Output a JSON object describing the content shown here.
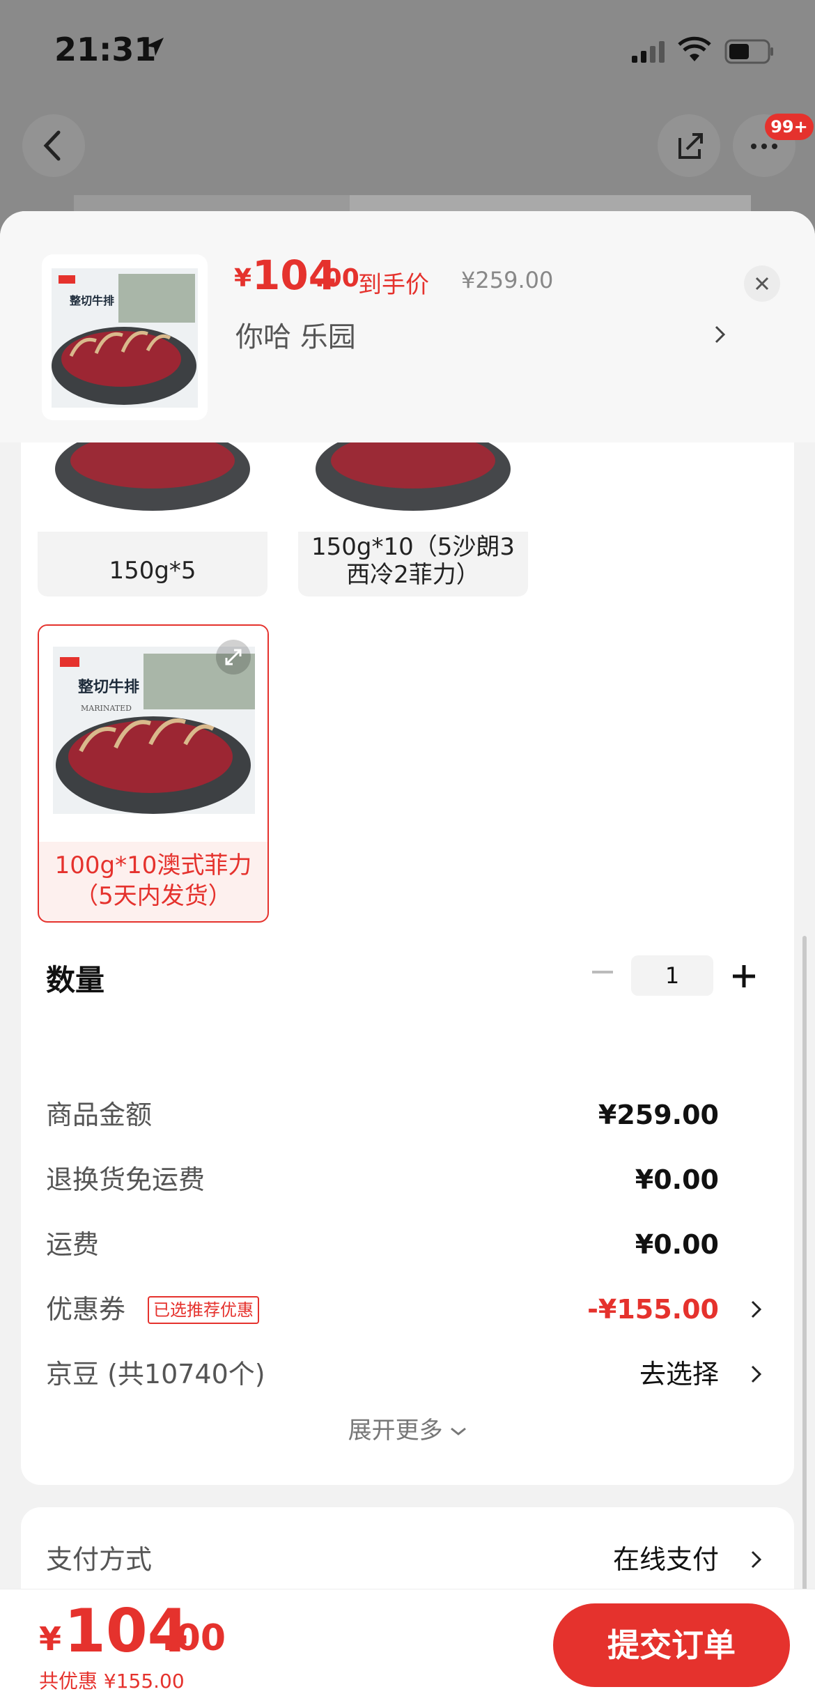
{
  "status_bar": {
    "time": "21:31"
  },
  "nav": {
    "badge": "99+"
  },
  "header": {
    "currency": "¥",
    "price_int": "104",
    "price_dec": ".00",
    "price_tag": "到手价",
    "original_price": "¥259.00",
    "variant": "你哈  乐园"
  },
  "options": [
    {
      "label": "150g*5"
    },
    {
      "label_line1": "150g*10（5沙朗3",
      "label_line2": "西冷2菲力）"
    },
    {
      "label_line1": "100g*10澳式菲力",
      "label_line2": "（5天内发货）"
    }
  ],
  "quantity": {
    "label": "数量",
    "value": "1"
  },
  "summary": {
    "rows": [
      {
        "key": "商品金额",
        "value": "¥259.00"
      },
      {
        "key": "退换货免运费",
        "value": "¥0.00"
      },
      {
        "key": "运费",
        "value": "¥0.00"
      },
      {
        "key": "优惠券",
        "tag": "已选推荐优惠",
        "value": "-¥155.00"
      },
      {
        "key": "京豆 (共10740个)",
        "value": "去选择"
      }
    ],
    "expand_more": "展开更多"
  },
  "payment": {
    "key": "支付方式",
    "value": "在线支付"
  },
  "bottom": {
    "currency": "¥",
    "total_int": "104",
    "total_dec": ".00",
    "saving": "共优惠 ¥155.00",
    "submit": "提交订单"
  },
  "colors": {
    "accent": "#e5322d"
  }
}
